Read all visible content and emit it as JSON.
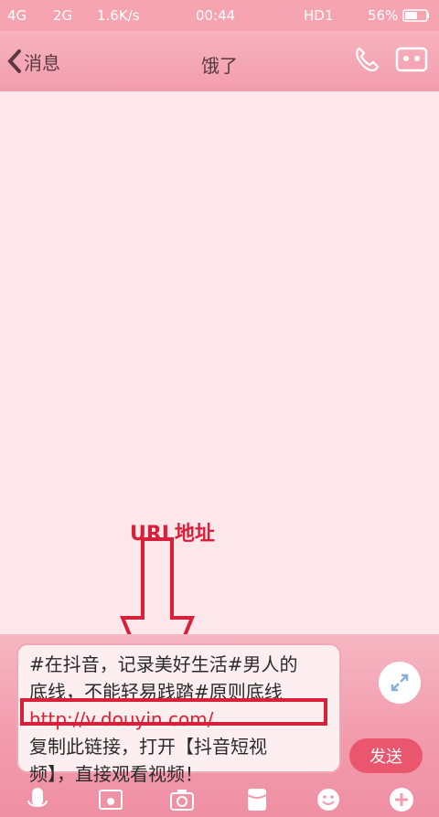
{
  "status_bar": {
    "network1": "4G",
    "network2": "2G",
    "speed": "1.6K/s",
    "time": "00:44",
    "hd": "HD1",
    "battery": "56%"
  },
  "header": {
    "back_label": "消息",
    "title": "饿了"
  },
  "annotation": {
    "label": "URL地址",
    "color": "#d8203a"
  },
  "input": {
    "line1": "#在抖音，记录美好生活#男人的",
    "line2": "底线，不能轻易践踏#原则底线",
    "line3": "http://v.douyin.com/...",
    "line4": "复制此链接，打开【抖音短视",
    "line5": "频】，直接观看视频！"
  },
  "send_label": "发送",
  "icons": {
    "back": "chevron-left-icon",
    "phone": "phone-icon",
    "profile": "profile-icon",
    "expand": "expand-icon",
    "voice": "microphone-icon",
    "photo": "image-icon",
    "camera": "camera-icon",
    "red_packet": "red-packet-icon",
    "emoji": "emoji-icon",
    "more": "plus-icon"
  },
  "colors": {
    "theme_pink": "#f29cad",
    "send_button": "#e9566d",
    "highlight_red": "#d8203a"
  }
}
